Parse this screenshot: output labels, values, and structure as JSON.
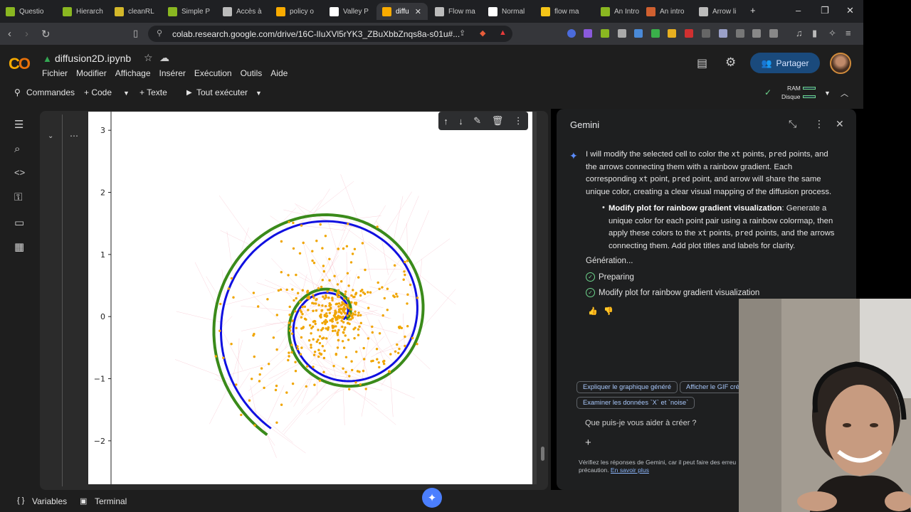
{
  "browser": {
    "tabs": [
      {
        "label": "Questio",
        "color": "#8ab721"
      },
      {
        "label": "Hierarch",
        "color": "#8ab721"
      },
      {
        "label": "cleanRL",
        "color": "#d4b82a"
      },
      {
        "label": "Simple P",
        "color": "#8ab721"
      },
      {
        "label": "Accès à",
        "color": "#bbbbbb"
      },
      {
        "label": "policy o",
        "color": "#f9ab00"
      },
      {
        "label": "Valley P",
        "color": "#ffffff"
      },
      {
        "label": "diffu",
        "color": "#f9ab00",
        "active": true
      },
      {
        "label": "Flow ma",
        "color": "#bbbbbb"
      },
      {
        "label": "Normal",
        "color": "#ffffff"
      },
      {
        "label": "flow ma",
        "color": "#f5c518"
      },
      {
        "label": "An Intro",
        "color": "#8ab721"
      },
      {
        "label": "An intro",
        "color": "#d06030"
      },
      {
        "label": "Arrow li",
        "color": "#bbbbbb"
      }
    ],
    "url": "colab.research.google.com/drive/16C-lIuXVl5rYK3_ZBuXbbZnqs8a-s01u#..."
  },
  "notebook": {
    "title": "diffusion2D.ipynb",
    "menu": [
      "Fichier",
      "Modifier",
      "Affichage",
      "Insérer",
      "Exécution",
      "Outils",
      "Aide"
    ],
    "toolbar": {
      "commands": "Commandes",
      "code": "+ Code",
      "text": "+ Texte",
      "run_all": "Tout exécuter",
      "ram": "RAM",
      "disk": "Disque"
    },
    "share": "Partager"
  },
  "chart_data": {
    "type": "scatter",
    "title": "",
    "xlabel": "",
    "ylabel": "",
    "ytick_labels": [
      "3",
      "2",
      "1",
      "0",
      "−1",
      "−2"
    ],
    "ylim_visible": [
      -2.7,
      3.3
    ],
    "series": [
      {
        "kind": "line",
        "color": "#3a8a1a",
        "shape": "spiral (outer)"
      },
      {
        "kind": "line",
        "color": "#1010e0",
        "shape": "spiral (inner)"
      },
      {
        "kind": "points",
        "color": "#f0a500",
        "shape": "scattered around spiral"
      },
      {
        "kind": "arrows",
        "color": "#f6b6c4",
        "shape": "faint connecting lines"
      }
    ]
  },
  "gemini": {
    "title": "Gemini",
    "message": {
      "p1": "I will modify the selected cell to color the",
      "c1": "xt",
      "p2": "points,",
      "c2": "pred",
      "p3": "points, and the arrows connecting them with a rainbow gradient. Each corresponding",
      "c3": "xt",
      "p4": "point,",
      "c4": "pred",
      "p5": "point, and arrow will share the same unique color, creating a clear visual mapping of the diffusion process."
    },
    "bullet": {
      "bold": "Modify plot for rainbow gradient visualization",
      "t1": ": Generate a unique color for each point pair using a rainbow colormap, then apply these colors to the",
      "c1": "xt",
      "t2": "points,",
      "c2": "pred",
      "t3": "points, and the arrows connecting them. Add plot titles and labels for clarity."
    },
    "generating": "Génération...",
    "steps": [
      "Preparing",
      "Modify plot for rainbow gradient visualization"
    ],
    "chips": [
      "Expliquer le graphique généré",
      "Afficher le GIF cré",
      "Examiner les données `X` et `noise`"
    ],
    "input_placeholder": "Que puis-je vous aider à créer ?",
    "disclaimer": "Vérifiez les réponses de Gemini, car il peut faire des erreu",
    "disclaimer2": "précaution.",
    "learn_more": "En savoir plus"
  },
  "bottom": {
    "variables": "Variables",
    "terminal": "Terminal"
  }
}
